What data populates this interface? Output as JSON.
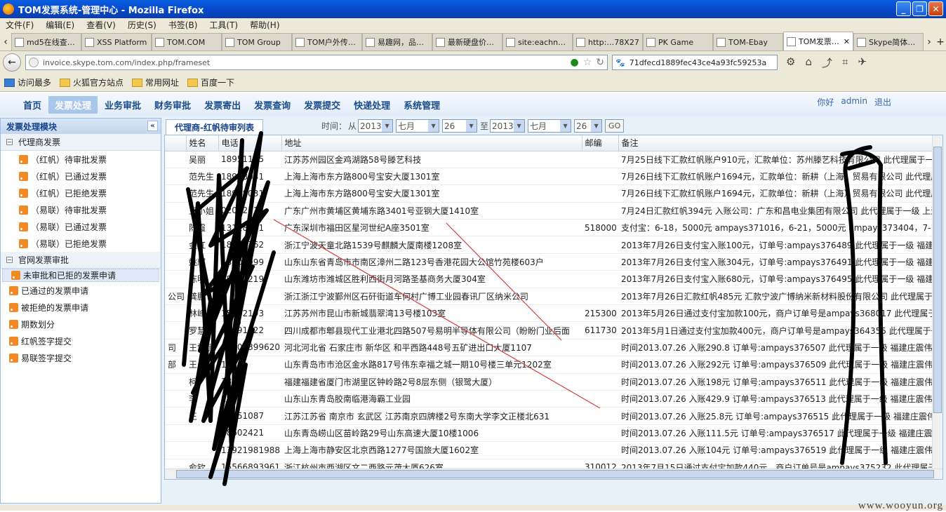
{
  "window": {
    "title": "TOM发票系统-管理中心 - Mozilla Firefox"
  },
  "menubar": [
    "文件(F)",
    "编辑(E)",
    "查看(V)",
    "历史(S)",
    "书签(B)",
    "工具(T)",
    "帮助(H)"
  ],
  "browser_tabs": [
    {
      "label": "md5在线查…"
    },
    {
      "label": "XSS Platform"
    },
    {
      "label": "TOM.COM"
    },
    {
      "label": "TOM Group"
    },
    {
      "label": "TOM户外传…"
    },
    {
      "label": "易趣网，品…"
    },
    {
      "label": "最新硬盘价…"
    },
    {
      "label": "site:eachn…"
    },
    {
      "label": "http:…78X27"
    },
    {
      "label": "PK Game"
    },
    {
      "label": "TOM-Ebay"
    },
    {
      "label": "TOM发票…",
      "active": true
    },
    {
      "label": "Skype简体…"
    }
  ],
  "urlbar": {
    "url": "invoice.skype.tom.com/index.php/frameset",
    "search": "71dfecd1889fec43ce4a93fc59253a"
  },
  "bookmarks": [
    "访问最多",
    "火狐官方站点",
    "常用网址",
    "百度一下"
  ],
  "topnav": {
    "items": [
      "首页",
      "发票处理",
      "业务审批",
      "财务审批",
      "发票寄出",
      "发票查询",
      "发票提交",
      "快递处理",
      "系统管理"
    ],
    "active_index": 1,
    "greeting": "你好",
    "user": "admin",
    "logout": "退出"
  },
  "sidebar": {
    "title": "发票处理模块",
    "groups": [
      {
        "label": "代理商发票",
        "items": [
          "（红帆）待审批发票",
          "（红帆）已通过发票",
          "（红帆）已拒绝发票",
          "（易联）待审批发票",
          "（易联）已通过发票",
          "（易联）已拒绝发票"
        ]
      },
      {
        "label": "官网发票审批",
        "items": [
          "未审批和已拒的发票申请",
          "已通过的发票申请",
          "被拒绝的发票申请",
          "期数划分",
          "红帆签字提交",
          "易联签字提交"
        ],
        "selected": 0
      }
    ]
  },
  "main": {
    "tab_label": "代理商-红帆待审列表",
    "filter": {
      "time_label": "时间：",
      "from_label": "从",
      "to_label": "至",
      "from_year": "2013",
      "from_month": "七月",
      "from_day": "26",
      "to_year": "2013",
      "to_month": "七月",
      "to_day": "26",
      "go": "GO"
    },
    "columns": [
      "",
      "姓名",
      "电话",
      "地址",
      "邮编",
      "备注"
    ],
    "rows": [
      [
        "",
        "吴丽",
        "18951165",
        "江苏苏州园区金鸡湖路58号滕艺科技",
        "",
        "7月25日线下汇款红帆账户910元，汇款单位：苏州滕艺科技有限公司 此代理属于一"
      ],
      [
        "",
        "范先生",
        "18918031",
        "上海上海市东方路800号宝安大厦1301室",
        "",
        "7月26日线下汇款红帆账户1694元，汇款单位：新耕（上海）贸易有限公司 此代理属"
      ],
      [
        "",
        "范先生",
        "18918031",
        "上海上海市东方路800号宝安大厦1301室",
        "",
        "7月26日线下汇款红帆账户1694元，汇款单位：新耕（上海）贸易有限公司 此代理属"
      ],
      [
        "",
        "王小姐",
        "02062518",
        "广东广州市黄埔区黄埔东路3401号亚钢大厦1410室",
        "",
        "7月24日汇款红帆394元 入账公司：广东和昌电业集团有限公司 此代理属于一级 上海"
      ],
      [
        "",
        "陈霞",
        "13128711",
        "广东深圳市福田区星河世纪A座3501室",
        "518000",
        "支付宝：6-18，5000元 ampays371016，6-21，5000元 ampays373404，7-11"
      ],
      [
        "",
        "金红",
        "18052762",
        "浙江宁波天童北路1539号麒麟大厦南楼1208室",
        "",
        "2013年7月26日支付宝入账100元，订单号:ampays376489 此代理属于一级 福建庄"
      ],
      [
        "",
        "姚辉",
        "13905099",
        "山东山东省青岛市市南区漳州二路123号香港花园大公馆竹苑楼603户",
        "",
        "2013年7月26日支付宝入账304元，订单号:ampays376491 此代理属于一级 福建庄"
      ],
      [
        "",
        "陈明",
        "15192219",
        "山东潍坊市潍城区胜利西街月河路圣基商务大厦304室",
        "",
        "2013年7月26日支付宝入账680元，订单号:ampays376495 此代理属于一级 福建庄"
      ],
      [
        "公司",
        "龚鹏",
        "",
        "浙江浙江宁波鄞州区石矸街道车何村广博工业园春讯厂区纳米公司",
        "",
        "2013年7月26日汇款红帆485元 汇款宁波广博纳米新材料股份有限公司 此代理属于一"
      ],
      [
        "",
        "林峰",
        "15862193",
        "江苏苏州市昆山市新城翡翠湾13号楼103室",
        "215300",
        "2013年5月26日通过支付宝加款100元，商户订单号是ampays368017 此代理属于一"
      ],
      [
        "",
        "罗慧敏",
        "18091922",
        "四川成都市郫县现代工业港北四路507号易明半导体有限公司（盼盼门业后面",
        "611730",
        "2013年5月1日通过支付宝加款400元，商户订单号是ampays364355 此代理属于一"
      ],
      [
        "司",
        "王雪丽",
        "13803399620",
        "河北河北省 石家庄市 新华区 和平西路448号五矿进出口大厦1107",
        "",
        "时间2013.07.26 入账290.8 订单号:ampays376507 此代理属于一级 福建庄震伟"
      ],
      [
        "部",
        "王",
        "18",
        "山东青岛市市沧区金水路817号伟东幸福之城一期10号楼三单元1202室",
        "",
        "时间2013.07.26 入账292元 订单号:ampays376509 此代理属于一级 福建庄震伟"
      ],
      [
        "",
        "柯",
        "13",
        "福建福建省厦门市湖里区钟岭路2号8层东侧（银鹭大厦）",
        "",
        "时间2013.07.26 入账198元 订单号:ampays376511 此代理属于一级 福建庄震伟"
      ],
      [
        "",
        "李",
        "1397",
        "山东山东青岛胶南临港海霸工业园",
        "",
        "时间2013.07.26 入账429.9 订单号:ampays376513 此代理属于一级 福建庄震伟"
      ],
      [
        "",
        "王",
        "13051087",
        "江苏江苏省 南京市 玄武区 江苏南京四牌楼2号东南大学李文正楼北631",
        "",
        "时间2013.07.26 入账25.8元 订单号:ampays376515 此代理属于一级 福建庄震伟"
      ],
      [
        "",
        "",
        "18602421",
        "山东青岛崂山区苗岭路29号山东高速大厦10楼1006",
        "",
        "时间2013.07.26 入账111.5元 订单号:ampays376517 此代理属于一级 福建庄震伟"
      ],
      [
        "",
        "",
        "13921981988",
        "上海上海市静安区北京西路1277号国旅大厦1602室",
        "",
        "时间2013.07.26 入账104元 订单号:ampays376519 此代理属于一级 福建庄震伟"
      ],
      [
        "",
        "俞钦",
        "15566893961",
        "浙江杭州市西湖区文二西路元茂大厦626室",
        "310012",
        "2013年7月15日通过支付宝加款440元，商户订单号是ampays375232 此代理属于一"
      ]
    ]
  },
  "watermark": "www.wooyun.org"
}
